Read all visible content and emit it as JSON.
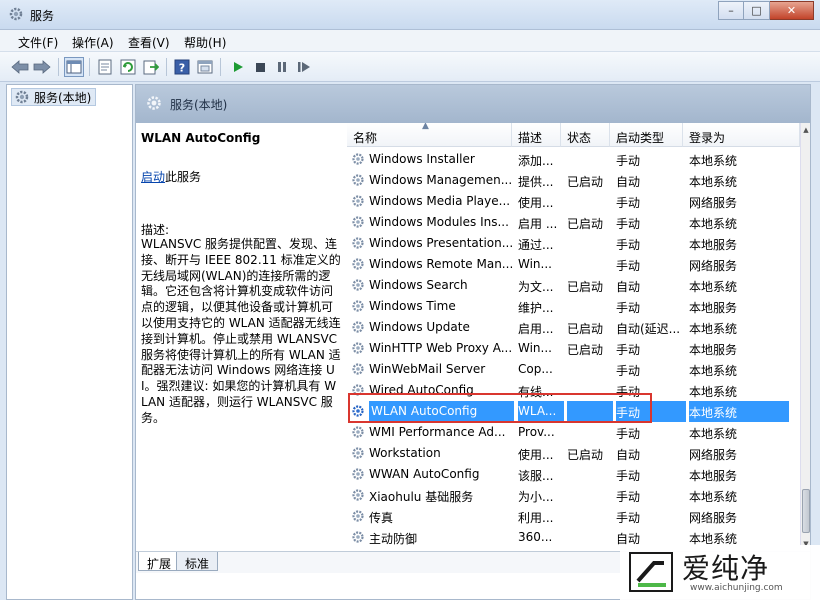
{
  "window": {
    "title": "服务",
    "buttons": [
      "–",
      "□",
      "✕"
    ]
  },
  "menu": [
    "文件(F)",
    "操作(A)",
    "查看(V)",
    "帮助(H)"
  ],
  "tree": {
    "item": "服务(本地)"
  },
  "header": {
    "title": "服务(本地)"
  },
  "description": {
    "service_name": "WLAN AutoConfig",
    "start_link": "启动",
    "start_suffix": "此服务",
    "label": "描述:",
    "text": "WLANSVC 服务提供配置、发现、连接、断开与 IEEE 802.11 标准定义的无线局域网(WLAN)的连接所需的逻辑。它还包含将计算机变成软件访问点的逻辑，以便其他设备或计算机可以使用支持它的 WLAN 适配器无线连接到计算机。停止或禁用 WLANSVC 服务将使得计算机上的所有 WLAN 适配器无法访问 Windows 网络连接 UI。强烈建议: 如果您的计算机具有 WLAN 适配器，则运行 WLANSVC 服务。"
  },
  "columns": [
    "名称",
    "描述",
    "状态",
    "启动类型",
    "登录为"
  ],
  "rows": [
    {
      "name": "Windows Installer",
      "desc": "添加...",
      "status": "",
      "startup": "手动",
      "logon": "本地系统"
    },
    {
      "name": "Windows Managemen...",
      "desc": "提供...",
      "status": "已启动",
      "startup": "自动",
      "logon": "本地系统"
    },
    {
      "name": "Windows Media Playe...",
      "desc": "使用...",
      "status": "",
      "startup": "手动",
      "logon": "网络服务"
    },
    {
      "name": "Windows Modules Ins...",
      "desc": "启用 ...",
      "status": "已启动",
      "startup": "手动",
      "logon": "本地系统"
    },
    {
      "name": "Windows Presentation...",
      "desc": "通过...",
      "status": "",
      "startup": "手动",
      "logon": "本地服务"
    },
    {
      "name": "Windows Remote Man...",
      "desc": "Win...",
      "status": "",
      "startup": "手动",
      "logon": "网络服务"
    },
    {
      "name": "Windows Search",
      "desc": "为文...",
      "status": "已启动",
      "startup": "自动",
      "logon": "本地系统"
    },
    {
      "name": "Windows Time",
      "desc": "维护...",
      "status": "",
      "startup": "手动",
      "logon": "本地服务"
    },
    {
      "name": "Windows Update",
      "desc": "启用...",
      "status": "已启动",
      "startup": "自动(延迟...",
      "logon": "本地系统"
    },
    {
      "name": "WinHTTP Web Proxy A...",
      "desc": "Win...",
      "status": "已启动",
      "startup": "手动",
      "logon": "本地服务"
    },
    {
      "name": "WinWebMail Server",
      "desc": "Cop...",
      "status": "",
      "startup": "手动",
      "logon": "本地系统"
    },
    {
      "name": "Wired AutoConfig",
      "desc": "有线...",
      "status": "",
      "startup": "手动",
      "logon": "本地系统"
    },
    {
      "name": "WLAN AutoConfig",
      "desc": "WLA...",
      "status": "",
      "startup": "手动",
      "logon": "本地系统",
      "selected": true
    },
    {
      "name": "WMI Performance Ad...",
      "desc": "Prov...",
      "status": "",
      "startup": "手动",
      "logon": "本地系统"
    },
    {
      "name": "Workstation",
      "desc": "使用...",
      "status": "已启动",
      "startup": "自动",
      "logon": "网络服务"
    },
    {
      "name": "WWAN AutoConfig",
      "desc": "该服...",
      "status": "",
      "startup": "手动",
      "logon": "本地服务"
    },
    {
      "name": "Xiaohulu 基础服务",
      "desc": "为小...",
      "status": "",
      "startup": "手动",
      "logon": "本地系统"
    },
    {
      "name": "传真",
      "desc": "利用...",
      "status": "",
      "startup": "手动",
      "logon": "网络服务"
    },
    {
      "name": "主动防御",
      "desc": "360...",
      "status": "",
      "startup": "自动",
      "logon": "本地系统"
    }
  ],
  "tabs": [
    "扩展",
    "标准"
  ],
  "watermark": {
    "text": "爱纯净",
    "url": "www.aichunjing.com"
  },
  "colors": {
    "selection": "#3399ff",
    "highlight_border": "#d9362f",
    "header_bg": "#a3b6cd"
  },
  "icons": [
    "gear-icon",
    "back-icon",
    "forward-icon",
    "console-tree-icon",
    "properties-icon",
    "refresh-icon",
    "export-icon",
    "help-icon",
    "view-icon",
    "play-icon",
    "stop-icon",
    "pause-icon",
    "restart-icon"
  ]
}
